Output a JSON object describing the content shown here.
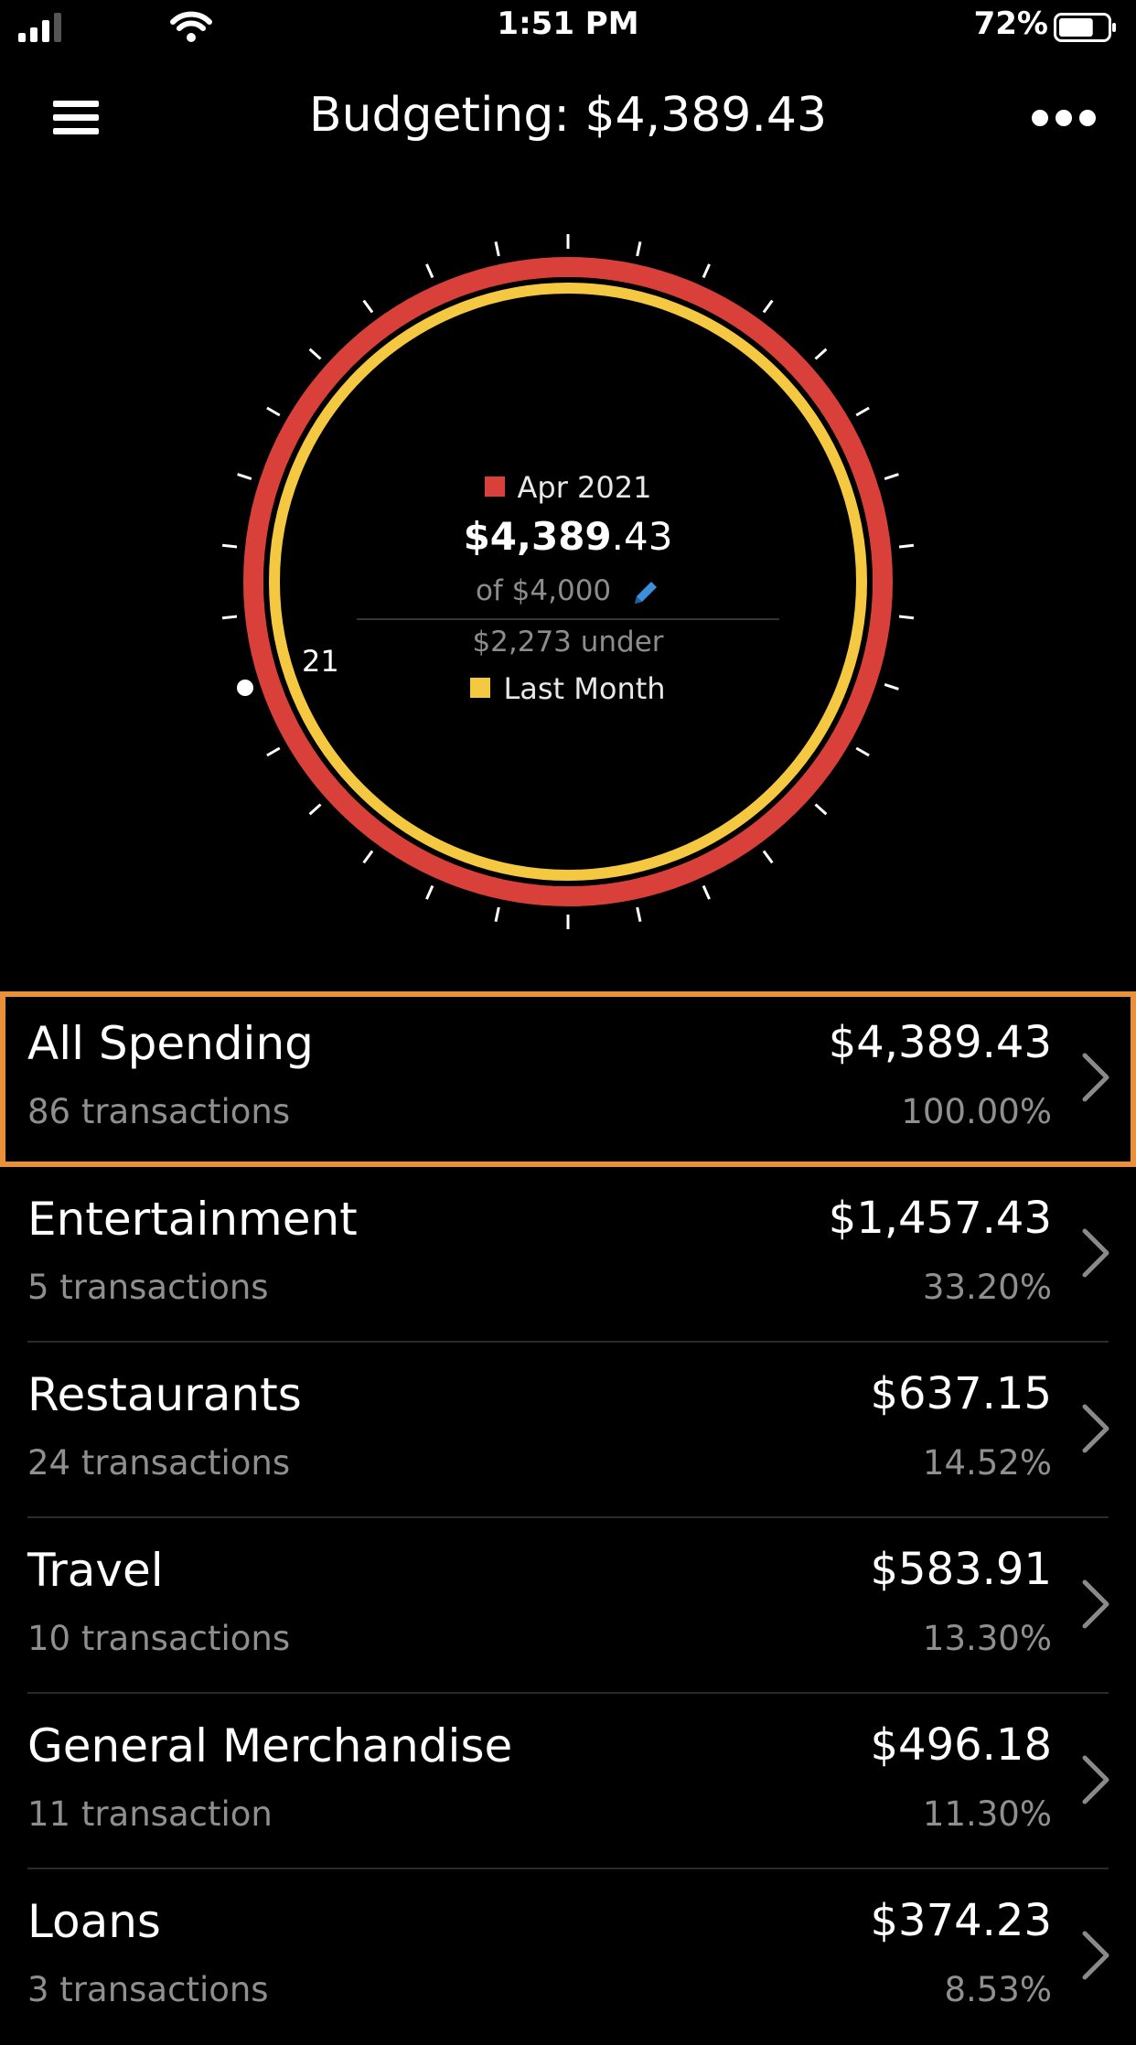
{
  "status": {
    "time": "1:51 PM",
    "battery": "72%",
    "battery_level": 0.72
  },
  "header": {
    "title": "Budgeting: $4,389.43",
    "menu_icon": "hamburger-menu-icon",
    "more_icon": "more-dots-icon"
  },
  "gauge": {
    "current_label": "Apr 2021",
    "current_color": "#D9403A",
    "spent_whole": "$4,389",
    "spent_cents": ".43",
    "of_text": "of $4,000",
    "under_text": "$2,273 under",
    "previous_label": "Last Month",
    "previous_color": "#F5C842",
    "day_marker": "21",
    "pencil_color": "#3D8FD9"
  },
  "categories": [
    {
      "name": "All Spending",
      "count": "86 transactions",
      "amount": "$4,389.43",
      "pct": "100.00%"
    },
    {
      "name": "Entertainment",
      "count": "5 transactions",
      "amount": "$1,457.43",
      "pct": "33.20%"
    },
    {
      "name": "Restaurants",
      "count": "24 transactions",
      "amount": "$637.15",
      "pct": "14.52%"
    },
    {
      "name": "Travel",
      "count": "10 transactions",
      "amount": "$583.91",
      "pct": "13.30%"
    },
    {
      "name": "General Merchandise",
      "count": "11 transaction",
      "amount": "$496.18",
      "pct": "11.30%"
    },
    {
      "name": "Loans",
      "count": "3 transactions",
      "amount": "$374.23",
      "pct": "8.53%"
    }
  ],
  "selection_color": "#E8913A"
}
